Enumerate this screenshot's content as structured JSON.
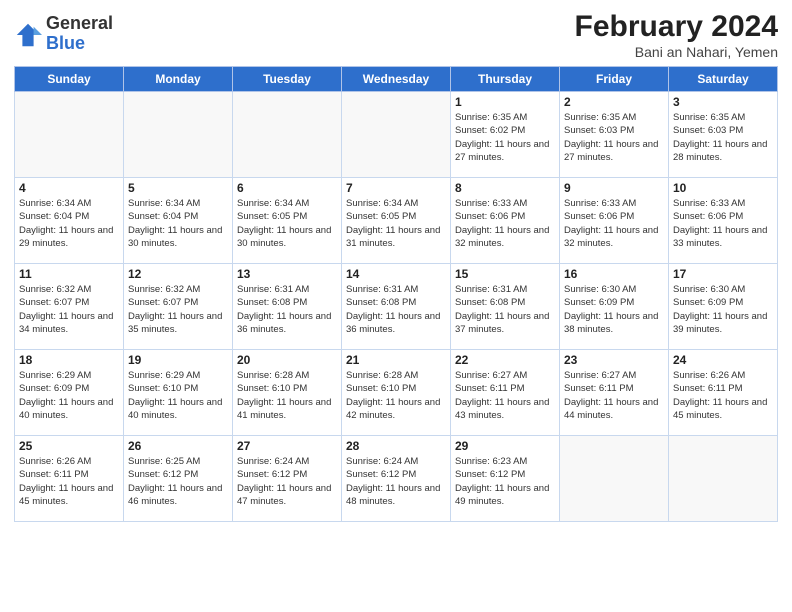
{
  "header": {
    "logo_general": "General",
    "logo_blue": "Blue",
    "month_year": "February 2024",
    "location": "Bani an Nahari, Yemen"
  },
  "weekdays": [
    "Sunday",
    "Monday",
    "Tuesday",
    "Wednesday",
    "Thursday",
    "Friday",
    "Saturday"
  ],
  "weeks": [
    [
      {
        "day": "",
        "info": ""
      },
      {
        "day": "",
        "info": ""
      },
      {
        "day": "",
        "info": ""
      },
      {
        "day": "",
        "info": ""
      },
      {
        "day": "1",
        "info": "Sunrise: 6:35 AM\nSunset: 6:02 PM\nDaylight: 11 hours and 27 minutes."
      },
      {
        "day": "2",
        "info": "Sunrise: 6:35 AM\nSunset: 6:03 PM\nDaylight: 11 hours and 27 minutes."
      },
      {
        "day": "3",
        "info": "Sunrise: 6:35 AM\nSunset: 6:03 PM\nDaylight: 11 hours and 28 minutes."
      }
    ],
    [
      {
        "day": "4",
        "info": "Sunrise: 6:34 AM\nSunset: 6:04 PM\nDaylight: 11 hours and 29 minutes."
      },
      {
        "day": "5",
        "info": "Sunrise: 6:34 AM\nSunset: 6:04 PM\nDaylight: 11 hours and 30 minutes."
      },
      {
        "day": "6",
        "info": "Sunrise: 6:34 AM\nSunset: 6:05 PM\nDaylight: 11 hours and 30 minutes."
      },
      {
        "day": "7",
        "info": "Sunrise: 6:34 AM\nSunset: 6:05 PM\nDaylight: 11 hours and 31 minutes."
      },
      {
        "day": "8",
        "info": "Sunrise: 6:33 AM\nSunset: 6:06 PM\nDaylight: 11 hours and 32 minutes."
      },
      {
        "day": "9",
        "info": "Sunrise: 6:33 AM\nSunset: 6:06 PM\nDaylight: 11 hours and 32 minutes."
      },
      {
        "day": "10",
        "info": "Sunrise: 6:33 AM\nSunset: 6:06 PM\nDaylight: 11 hours and 33 minutes."
      }
    ],
    [
      {
        "day": "11",
        "info": "Sunrise: 6:32 AM\nSunset: 6:07 PM\nDaylight: 11 hours and 34 minutes."
      },
      {
        "day": "12",
        "info": "Sunrise: 6:32 AM\nSunset: 6:07 PM\nDaylight: 11 hours and 35 minutes."
      },
      {
        "day": "13",
        "info": "Sunrise: 6:31 AM\nSunset: 6:08 PM\nDaylight: 11 hours and 36 minutes."
      },
      {
        "day": "14",
        "info": "Sunrise: 6:31 AM\nSunset: 6:08 PM\nDaylight: 11 hours and 36 minutes."
      },
      {
        "day": "15",
        "info": "Sunrise: 6:31 AM\nSunset: 6:08 PM\nDaylight: 11 hours and 37 minutes."
      },
      {
        "day": "16",
        "info": "Sunrise: 6:30 AM\nSunset: 6:09 PM\nDaylight: 11 hours and 38 minutes."
      },
      {
        "day": "17",
        "info": "Sunrise: 6:30 AM\nSunset: 6:09 PM\nDaylight: 11 hours and 39 minutes."
      }
    ],
    [
      {
        "day": "18",
        "info": "Sunrise: 6:29 AM\nSunset: 6:09 PM\nDaylight: 11 hours and 40 minutes."
      },
      {
        "day": "19",
        "info": "Sunrise: 6:29 AM\nSunset: 6:10 PM\nDaylight: 11 hours and 40 minutes."
      },
      {
        "day": "20",
        "info": "Sunrise: 6:28 AM\nSunset: 6:10 PM\nDaylight: 11 hours and 41 minutes."
      },
      {
        "day": "21",
        "info": "Sunrise: 6:28 AM\nSunset: 6:10 PM\nDaylight: 11 hours and 42 minutes."
      },
      {
        "day": "22",
        "info": "Sunrise: 6:27 AM\nSunset: 6:11 PM\nDaylight: 11 hours and 43 minutes."
      },
      {
        "day": "23",
        "info": "Sunrise: 6:27 AM\nSunset: 6:11 PM\nDaylight: 11 hours and 44 minutes."
      },
      {
        "day": "24",
        "info": "Sunrise: 6:26 AM\nSunset: 6:11 PM\nDaylight: 11 hours and 45 minutes."
      }
    ],
    [
      {
        "day": "25",
        "info": "Sunrise: 6:26 AM\nSunset: 6:11 PM\nDaylight: 11 hours and 45 minutes."
      },
      {
        "day": "26",
        "info": "Sunrise: 6:25 AM\nSunset: 6:12 PM\nDaylight: 11 hours and 46 minutes."
      },
      {
        "day": "27",
        "info": "Sunrise: 6:24 AM\nSunset: 6:12 PM\nDaylight: 11 hours and 47 minutes."
      },
      {
        "day": "28",
        "info": "Sunrise: 6:24 AM\nSunset: 6:12 PM\nDaylight: 11 hours and 48 minutes."
      },
      {
        "day": "29",
        "info": "Sunrise: 6:23 AM\nSunset: 6:12 PM\nDaylight: 11 hours and 49 minutes."
      },
      {
        "day": "",
        "info": ""
      },
      {
        "day": "",
        "info": ""
      }
    ]
  ]
}
